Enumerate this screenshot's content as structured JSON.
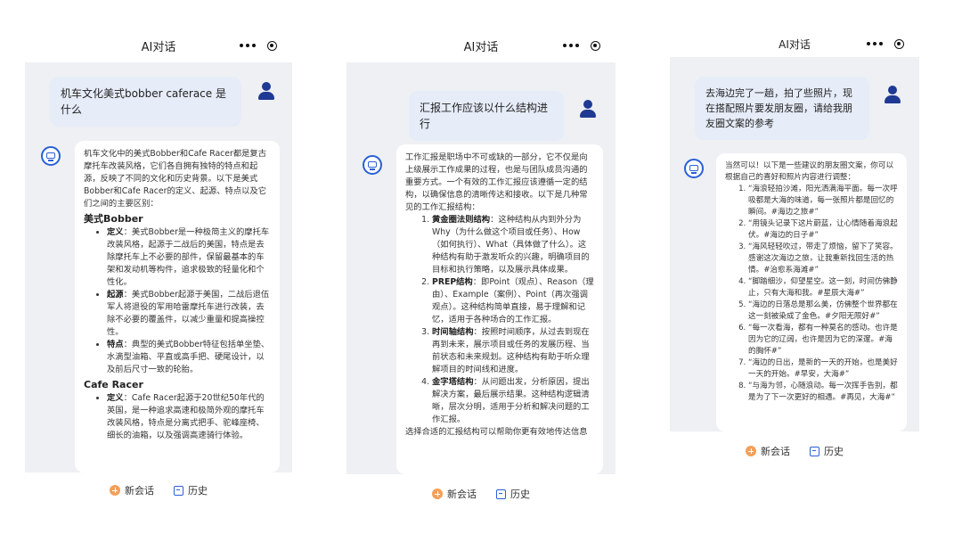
{
  "header_title": "AI对话",
  "footer": {
    "new_chat": "新会话",
    "history": "历史"
  },
  "panels": [
    {
      "user_message": "机车文化美式bobber caferace 是什么",
      "intro": "机车文化中的美式Bobber和Cafe Racer都是复古摩托车改装风格，它们各自拥有独特的特点和起源，反映了不同的文化和历史背景。以下是美式Bobber和Cafe Racer的定义、起源、特点以及它们之间的主要区别：",
      "sections": [
        {
          "title": "美式Bobber",
          "items": [
            {
              "label": "定义",
              "text": "：美式Bobber是一种极简主义的摩托车改装风格，起源于二战后的美国，特点是去除摩托车上不必要的部件，保留最基本的车架和发动机等构件，追求极致的轻量化和个性化。"
            },
            {
              "label": "起源",
              "text": "：美式Bobber起源于美国，二战后退伍军人将退役的军用哈雷摩托车进行改装，去除不必要的覆盖件，以减少重量和提高操控性。"
            },
            {
              "label": "特点",
              "text": "：典型的美式Bobber特征包括单坐垫、水滴型油箱、平直或高手把、硬尾设计，以及前后尺寸一致的轮胎。"
            }
          ]
        },
        {
          "title": "Cafe Racer",
          "items": [
            {
              "label": "定义",
              "text": "：Cafe Racer起源于20世纪50年代的英国，是一种追求高速和极简外观的摩托车改装风格，特点是分离式把手、驼峰座椅、细长的油箱，以及强调高速骑行体验。"
            }
          ]
        }
      ]
    },
    {
      "user_message": "汇报工作应该以什么结构进行",
      "intro": "工作汇报是职场中不可或缺的一部分，它不仅是向上级展示工作成果的过程，也是与团队成员沟通的重要方式。一个有效的工作汇报应该遵循一定的结构，以确保信息的清晰传达和接收。以下是几种常见的工作汇报结构：",
      "items": [
        {
          "label": "黄金圈法则结构",
          "text": "：这种结构从内到外分为Why（为什么做这个项目或任务）、How（如何执行）、What（具体做了什么）。这种结构有助于激发听众的兴趣，明确项目的目标和执行策略，以及展示具体成果。"
        },
        {
          "label": "PREP结构",
          "text": "：即Point（观点）、Reason（理由）、Example（案例）、Point（再次强调观点）。这种结构简单直接，易于理解和记忆，适用于各种场合的工作汇报。"
        },
        {
          "label": "时间轴结构",
          "text": "：按照时间顺序，从过去到现在再到未来，展示项目或任务的发展历程、当前状态和未来规划。这种结构有助于听众理解项目的时间线和进度。"
        },
        {
          "label": "金字塔结构",
          "text": "：从问题出发，分析原因，提出解决方案，最后展示结果。这种结构逻辑清晰，层次分明，适用于分析和解决问题的工作汇报。"
        }
      ],
      "outro": "选择合适的汇报结构可以帮助你更有效地传达信息"
    },
    {
      "user_message": "去海边完了一趟，拍了些照片，现在搭配照片要发朋友圈，请给我朋友圈文案的参考",
      "intro": "当然可以！以下是一些建议的朋友圈文案，你可以根据自己的喜好和照片内容进行调整：",
      "items": [
        "“海浪轻拍沙滩，阳光洒满海平面。每一次呼吸都是大海的味道，每一张照片都是回忆的瞬间。#海边之旅#”",
        "“用镜头记录下这片蔚蓝，让心情随着海浪起伏。#海边的日子#”",
        "“海风轻轻吹过，带走了烦恼，留下了笑容。感谢这次海边之旅，让我重新找回生活的热情。#治愈系海滩#”",
        "“脚踏细沙，仰望星空。这一刻，时间仿佛静止，只有大海和我。#星辰大海#”",
        "“海边的日落总是那么美，仿佛整个世界都在这一刻被染成了金色。#夕阳无限好#”",
        "“每一次看海，都有一种莫名的感动。也许是因为它的辽阔，也许是因为它的深邃。#海的胸怀#”",
        "“海边的日出，是新的一天的开始，也是美好一天的开始。#早安，大海#”",
        "“与海为邻，心随浪动。每一次挥手告别，都是为了下一次更好的相遇。#再见，大海#”"
      ]
    }
  ]
}
